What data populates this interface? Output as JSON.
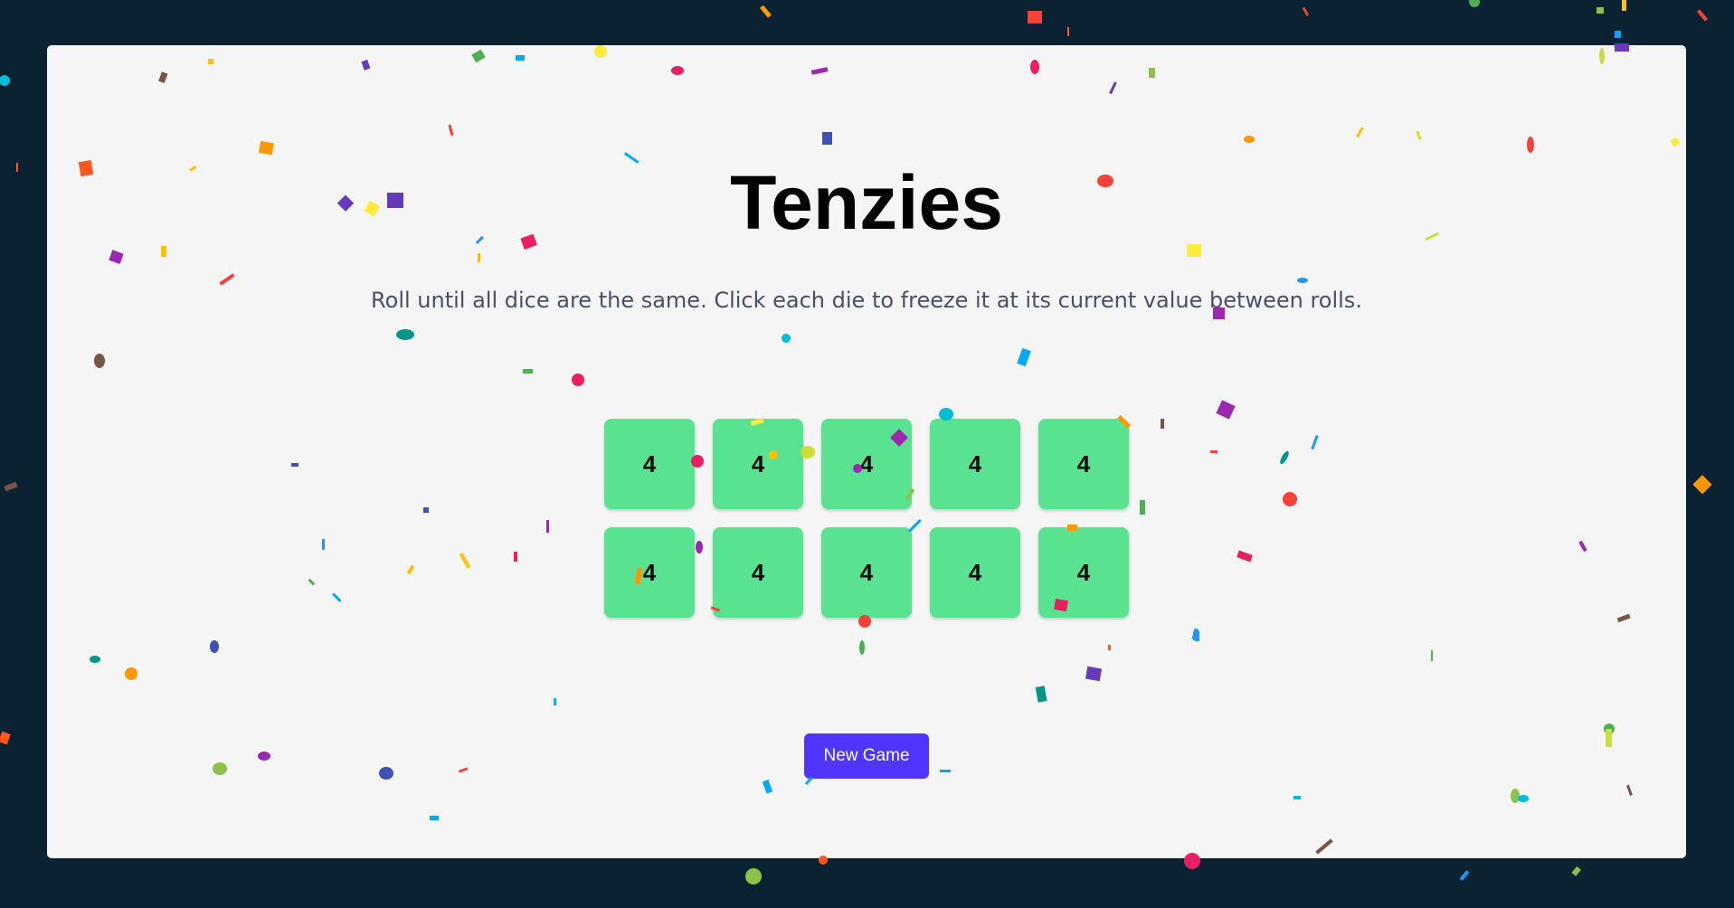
{
  "app": {
    "title": "Tenzies",
    "instructions": "Roll until all dice are the same. Click each die to freeze it at its current value between rolls."
  },
  "dice": [
    {
      "value": "4"
    },
    {
      "value": "4"
    },
    {
      "value": "4"
    },
    {
      "value": "4"
    },
    {
      "value": "4"
    },
    {
      "value": "4"
    },
    {
      "value": "4"
    },
    {
      "value": "4"
    },
    {
      "value": "4"
    },
    {
      "value": "4"
    }
  ],
  "controls": {
    "new_game_label": "New Game"
  },
  "colors": {
    "page_background": "#0b2233",
    "board_background": "#f5f5f5",
    "die_held": "#59e391",
    "button": "#5035ff"
  },
  "celebration": {
    "confetti": true
  }
}
